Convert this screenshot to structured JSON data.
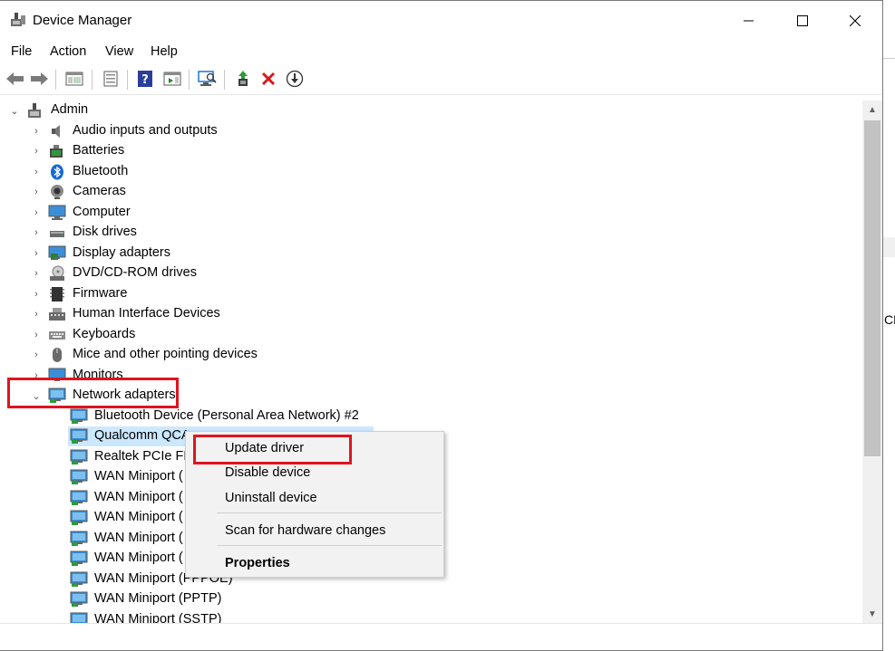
{
  "window": {
    "title": "Device Manager"
  },
  "menubar": [
    "File",
    "Action",
    "View",
    "Help"
  ],
  "toolbar": [
    "back-icon",
    "forward-icon",
    "show-hide-console-tree-icon",
    "properties-icon",
    "help-icon",
    "show-action-pane-icon",
    "scan-hardware-icon",
    "update-driver-icon",
    "uninstall-icon",
    "download-icon"
  ],
  "tree": {
    "root": "Admin",
    "categories": [
      "Audio inputs and outputs",
      "Batteries",
      "Bluetooth",
      "Cameras",
      "Computer",
      "Disk drives",
      "Display adapters",
      "DVD/CD-ROM drives",
      "Firmware",
      "Human Interface Devices",
      "Keyboards",
      "Mice and other pointing devices",
      "Monitors",
      "Network adapters"
    ],
    "network_devices": [
      "Bluetooth Device (Personal Area Network) #2",
      "Qualcomm QCA",
      "Realtek PCIe FE",
      "WAN Miniport (",
      "WAN Miniport (",
      "WAN Miniport (",
      "WAN Miniport (",
      "WAN Miniport (",
      "WAN Miniport (PPPOE)",
      "WAN Miniport (PPTP)",
      "WAN Miniport (SSTP)"
    ]
  },
  "context_menu": {
    "update_driver": "Update driver",
    "disable_device": "Disable device",
    "uninstall_device": "Uninstall device",
    "scan_hardware": "Scan for hardware changes",
    "properties": "Properties"
  },
  "background_window": {
    "fragment": "CP"
  },
  "colors": {
    "highlight": "#e0141e",
    "selection": "#cce8ff",
    "menu_bg": "#f2f2f2"
  }
}
